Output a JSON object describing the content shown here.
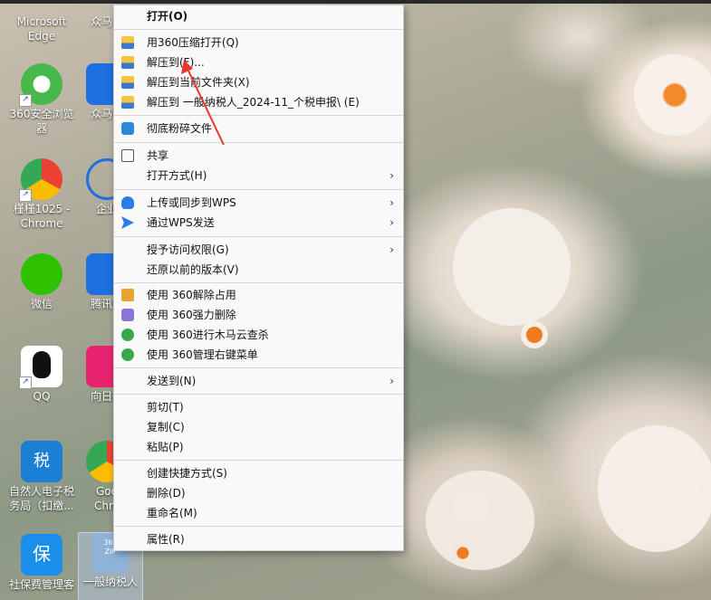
{
  "desktop": {
    "icons": [
      {
        "label": "Microsoft\nEdge"
      },
      {
        "label": "众马云"
      },
      {
        "label": "360安全浏览\n器"
      },
      {
        "label": "众马财"
      },
      {
        "label": "槿槿1025 -\nChrome"
      },
      {
        "label": "企业"
      },
      {
        "label": "微信"
      },
      {
        "label": "腾讯电"
      },
      {
        "label": "QQ"
      },
      {
        "label": "向日葵"
      },
      {
        "label": "自然人电子税\n务局（扣缴..."
      },
      {
        "label": "Goo\nChro"
      },
      {
        "label": "社保费管理客"
      },
      {
        "label": "一般纳税人"
      }
    ],
    "zip_badge": "360\nZIP",
    "tax_badge": "税",
    "shebao_badge": "保"
  },
  "menu": {
    "items": [
      {
        "label": "打开(O)"
      },
      {
        "label": "用360压缩打开(Q)"
      },
      {
        "label": "解压到(F)..."
      },
      {
        "label": "解压到当前文件夹(X)"
      },
      {
        "label": "解压到 一般纳税人_2024-11_个税申报\\ (E)"
      },
      {
        "label": "彻底粉碎文件"
      },
      {
        "label": "共享"
      },
      {
        "label": "打开方式(H)"
      },
      {
        "label": "上传或同步到WPS"
      },
      {
        "label": "通过WPS发送"
      },
      {
        "label": "授予访问权限(G)"
      },
      {
        "label": "还原以前的版本(V)"
      },
      {
        "label": "使用 360解除占用"
      },
      {
        "label": "使用 360强力删除"
      },
      {
        "label": "使用 360进行木马云查杀"
      },
      {
        "label": "使用 360管理右键菜单"
      },
      {
        "label": "发送到(N)"
      },
      {
        "label": "剪切(T)"
      },
      {
        "label": "复制(C)"
      },
      {
        "label": "粘贴(P)"
      },
      {
        "label": "创建快捷方式(S)"
      },
      {
        "label": "删除(D)"
      },
      {
        "label": "重命名(M)"
      },
      {
        "label": "属性(R)"
      }
    ],
    "submenu_arrow": "›"
  },
  "colors": {
    "annotation_arrow": "#e8382e",
    "menu_bg": "#f9f9f9"
  }
}
